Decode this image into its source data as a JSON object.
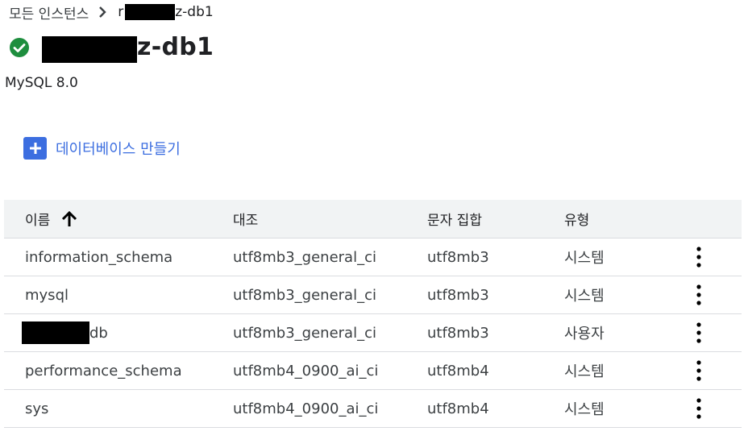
{
  "breadcrumb": {
    "all_instances": "모든 인스턴스",
    "current_prefix": "r",
    "current_suffix": "z-db1"
  },
  "instance": {
    "title_suffix": "z-db1",
    "status": "running",
    "version": "MySQL 8.0"
  },
  "actions": {
    "create_database": "데이터베이스 만들기"
  },
  "table": {
    "columns": {
      "name": "이름",
      "collation": "대조",
      "charset": "문자 집합",
      "type": "유형"
    },
    "rows": [
      {
        "name": "information_schema",
        "collation": "utf8mb3_general_ci",
        "charset": "utf8mb3",
        "type": "시스템"
      },
      {
        "name": "mysql",
        "collation": "utf8mb3_general_ci",
        "charset": "utf8mb3",
        "type": "시스템"
      },
      {
        "name": "db",
        "collation": "utf8mb3_general_ci",
        "charset": "utf8mb3",
        "type": "사용자"
      },
      {
        "name": "performance_schema",
        "collation": "utf8mb4_0900_ai_ci",
        "charset": "utf8mb4",
        "type": "시스템"
      },
      {
        "name": "sys",
        "collation": "utf8mb4_0900_ai_ci",
        "charset": "utf8mb4",
        "type": "시스템"
      }
    ]
  },
  "colors": {
    "accent": "#3c6ee0",
    "status_ok": "#1e8e3e",
    "header_bg": "#f1f3f4",
    "border": "#dadce0"
  },
  "icons": {
    "breadcrumb_separator": "chevron-right-icon",
    "status": "check-circle-icon",
    "create": "add-box-icon",
    "sort": "arrow-up-icon",
    "row_menu": "more-vert-icon"
  }
}
